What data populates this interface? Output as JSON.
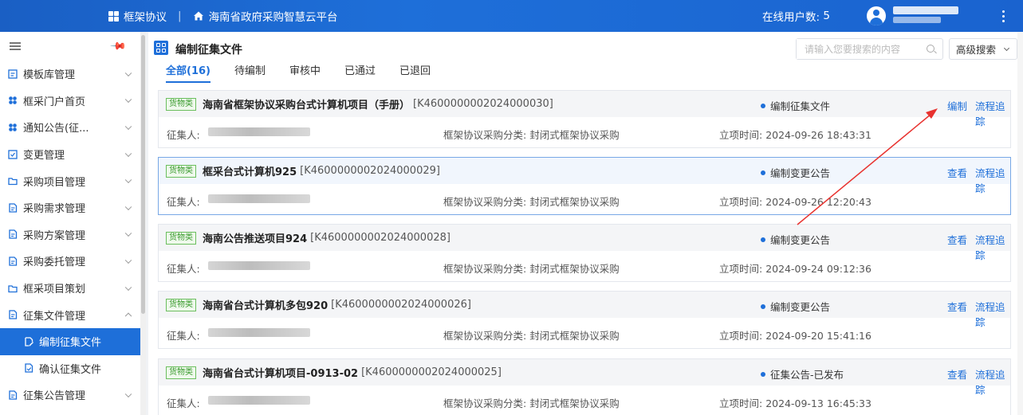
{
  "header": {
    "module": "框架协议",
    "platform": "海南省政府采购智慧云平台",
    "online_label": "在线用户数:",
    "online_count": "5"
  },
  "sidebar": {
    "items": [
      {
        "label": "模板库管理",
        "icon": "template-icon"
      },
      {
        "label": "框采门户首页",
        "icon": "portal-icon"
      },
      {
        "label": "通知公告(征...",
        "icon": "notice-icon"
      },
      {
        "label": "变更管理",
        "icon": "change-icon"
      },
      {
        "label": "采购项目管理",
        "icon": "folder-icon"
      },
      {
        "label": "采购需求管理",
        "icon": "doc-icon"
      },
      {
        "label": "采购方案管理",
        "icon": "doc-icon"
      },
      {
        "label": "采购委托管理",
        "icon": "doc-icon"
      },
      {
        "label": "框采项目策划",
        "icon": "folder-icon"
      },
      {
        "label": "征集文件管理",
        "icon": "doc-icon"
      },
      {
        "label": "编制征集文件",
        "icon": "edit-doc-icon"
      },
      {
        "label": "确认征集文件",
        "icon": "confirm-doc-icon"
      },
      {
        "label": "征集公告管理",
        "icon": "doc-icon"
      }
    ]
  },
  "page": {
    "title": "编制征集文件",
    "search_placeholder": "请输入您要搜索的内容",
    "advanced_search": "高级搜索",
    "tabs": [
      "全部(16)",
      "待编制",
      "审核中",
      "已通过",
      "已退回"
    ]
  },
  "labels": {
    "collector": "征集人:",
    "category_label": "框架协议采购分类:",
    "time_label": "立项时间:"
  },
  "projects": [
    {
      "tag": "货物类",
      "title": "海南省框架协议采购台式计算机项目（手册）",
      "code": "[K4600000002024000030]",
      "status": "编制征集文件",
      "action1": "编制",
      "action2": "流程追踪",
      "category": "封闭式框架协议采购",
      "time": "2024-09-26 18:43:31"
    },
    {
      "tag": "货物类",
      "title": "框采台式计算机925",
      "code": "[K4600000002024000029]",
      "status": "编制变更公告",
      "action1": "查看",
      "action2": "流程追踪",
      "category": "封闭式框架协议采购",
      "time": "2024-09-26 12:20:43"
    },
    {
      "tag": "货物类",
      "title": "海南公告推送项目924",
      "code": "[K4600000002024000028]",
      "status": "编制变更公告",
      "action1": "查看",
      "action2": "流程追踪",
      "category": "封闭式框架协议采购",
      "time": "2024-09-24 09:12:36"
    },
    {
      "tag": "货物类",
      "title": "海南省台式计算机多包920",
      "code": "[K4600000002024000026]",
      "status": "编制变更公告",
      "action1": "查看",
      "action2": "流程追踪",
      "category": "封闭式框架协议采购",
      "time": "2024-09-20 15:41:16"
    },
    {
      "tag": "货物类",
      "title": "海南省台式计算机项目-0913-02",
      "code": "[K4600000002024000025]",
      "status": "征集公告-已发布",
      "action1": "查看",
      "action2": "流程追踪",
      "category": "封闭式框架协议采购",
      "time": "2024-09-13 16:45:33"
    }
  ],
  "colors": {
    "primary": "#1e6fd9",
    "tag_green": "#3a9b2e",
    "annotation_arrow": "#e8322f"
  }
}
